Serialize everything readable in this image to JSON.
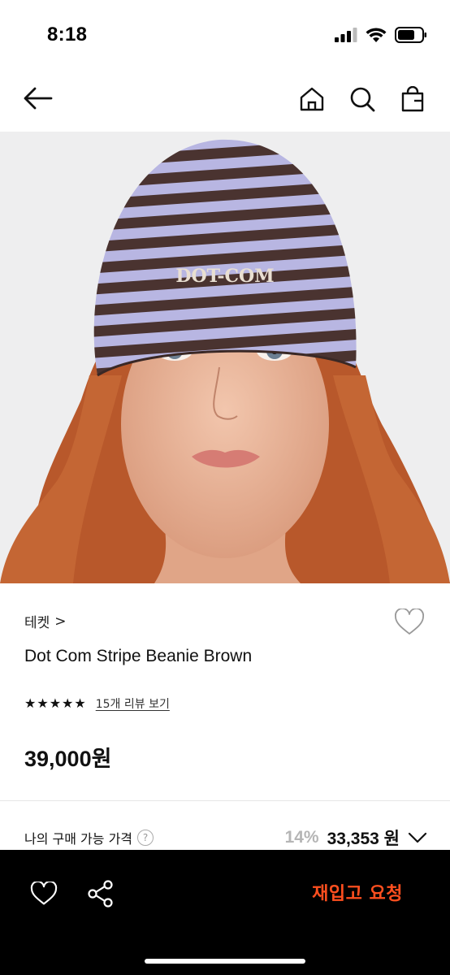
{
  "status_bar": {
    "time": "8:18"
  },
  "nav": {
    "back": "back-arrow-icon",
    "icons": [
      "home-icon",
      "search-icon",
      "shopping-bag-icon"
    ]
  },
  "product": {
    "image_cap_text": "DOT-COM",
    "brand": "테켓",
    "brand_chevron": ">",
    "title": "Dot Com Stripe Beanie Brown",
    "rating_stars": 5,
    "review_link": "15개 리뷰 보기",
    "price": "39,000원"
  },
  "my_price": {
    "label": "나의 구매 가능 가격",
    "help": "?",
    "discount": "14%",
    "value": "33,353 원"
  },
  "bottom_bar": {
    "restock_label": "재입고 요청"
  },
  "colors": {
    "accent": "#ff4f1f",
    "bottom_bar_bg": "#000000",
    "discount_gray": "#b5b5b5"
  }
}
